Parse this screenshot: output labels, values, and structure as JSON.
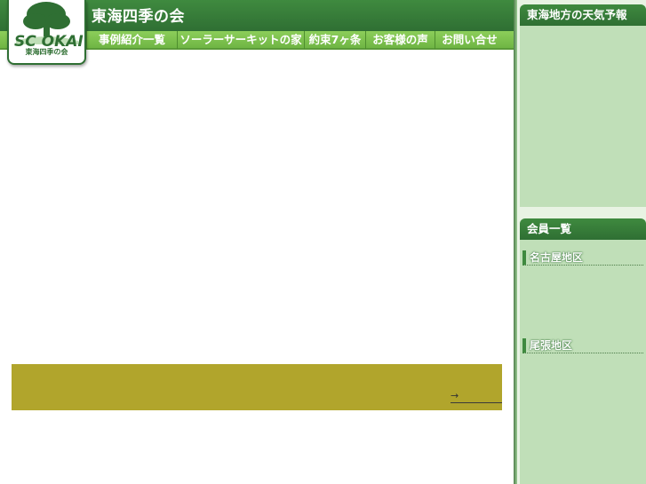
{
  "site": {
    "title": "東海四季の会",
    "logo_text": "SC OKAI",
    "logo_caption": "東海四季の会"
  },
  "nav": {
    "items": [
      {
        "label": "事例紹介一覧"
      },
      {
        "label": "ソーラーサーキットの家"
      },
      {
        "label": "約束7ヶ条"
      },
      {
        "label": "お客様の声"
      },
      {
        "label": "お問い合せ"
      }
    ]
  },
  "main": {
    "banner_link": "→"
  },
  "sidebar": {
    "weather_title": "東海地方の天気予報",
    "members_title": "会員一覧",
    "areas": [
      {
        "label": "名古屋地区"
      },
      {
        "label": "尾張地区"
      }
    ]
  },
  "colors": {
    "header_green": "#2f6f33",
    "nav_green": "#7cc24e",
    "banner_olive": "#b1a52c",
    "panel_green": "#c0dfb8"
  }
}
